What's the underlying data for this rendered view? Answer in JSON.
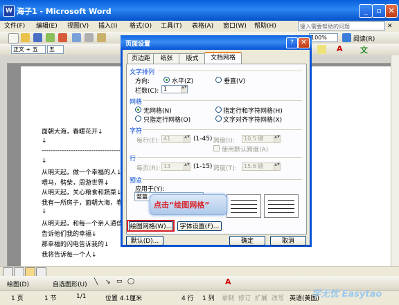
{
  "window": {
    "title": "海子1 - Microsoft Word",
    "app_icon": "W"
  },
  "menu": [
    "文件(F)",
    "编辑(E)",
    "视图(V)",
    "插入(I)",
    "格式(O)",
    "工具(T)",
    "表格(A)",
    "窗口(W)",
    "帮助(H)"
  ],
  "help_box": {
    "placeholder": "键入需要帮助的问题"
  },
  "toolbar": {
    "zoom": "100%",
    "read_label": "阅读(R)",
    "style": "正文 + 五",
    "font": "五"
  },
  "document": {
    "lines": [
      "面朝大海，春暖花开↓",
      "↓",
      "---------------------------------------------",
      "↓",
      "从明天起，做一个幸福的人↓",
      "喂马，劈柴，周游世界↓",
      "从明天起，关心粮食和蔬菜↓",
      "我有一所房子，面朝大海，春暖",
      "↓",
      "从明天起，和每一个亲人通信",
      "告诉他们我的幸福↓",
      "那幸福的闪电告诉我的↓",
      "我将告诉每一个人↓"
    ]
  },
  "drawbar": {
    "draw_label": "绘图(D)",
    "autoshape_label": "自选图形(U)"
  },
  "status": {
    "page": "1 页",
    "section": "1 节",
    "page_of": "1/1",
    "position": "位置 4.1厘米",
    "line": "4 行",
    "column": "1 列",
    "rec": "录制",
    "trk": "修订",
    "ext": "扩展",
    "ovr": "改写",
    "language": "英语(美国)"
  },
  "dialog": {
    "title": "页面设置",
    "tabs": [
      "页边距",
      "纸张",
      "版式",
      "文档网格"
    ],
    "active_tab": 3,
    "text_direction": {
      "section": "文字排列",
      "direction_label": "方向:",
      "horizontal": "水平(Z)",
      "vertical": "垂直(V)",
      "columns_label": "栏数(C):",
      "columns_value": "1"
    },
    "grid": {
      "section": "网格",
      "no_grid": "无网格(N)",
      "line_char_grid": "指定行和字符网格(H)",
      "line_only": "只指定行网格(O)",
      "char_align": "文字对齐字符网格(X)"
    },
    "chars": {
      "section": "字符",
      "per_line_label": "每行(E):",
      "per_line_value": "41",
      "range": "(1-45)",
      "pitch_label": "跨度(I):",
      "pitch_value": "10.5 磅",
      "default_pitch": "使用默认跨度(A)"
    },
    "lines": {
      "section": "行",
      "per_page_label": "每页(R):",
      "per_page_value": "13",
      "range": "(1-15)",
      "pitch_label": "跨度(T):",
      "pitch_value": "15.6 磅"
    },
    "preview": {
      "section": "预览",
      "apply_label": "应用于(Y):",
      "apply_value": "整篇"
    },
    "buttons": {
      "draw_grid": "绘图网格(W)...",
      "font_settings": "字体设置(F)...",
      "default": "默认(D)...",
      "ok": "确定",
      "cancel": "取消"
    }
  },
  "annotation": {
    "callout": "点击“绘图网格”",
    "watermark": "学无忧 Easytao"
  }
}
